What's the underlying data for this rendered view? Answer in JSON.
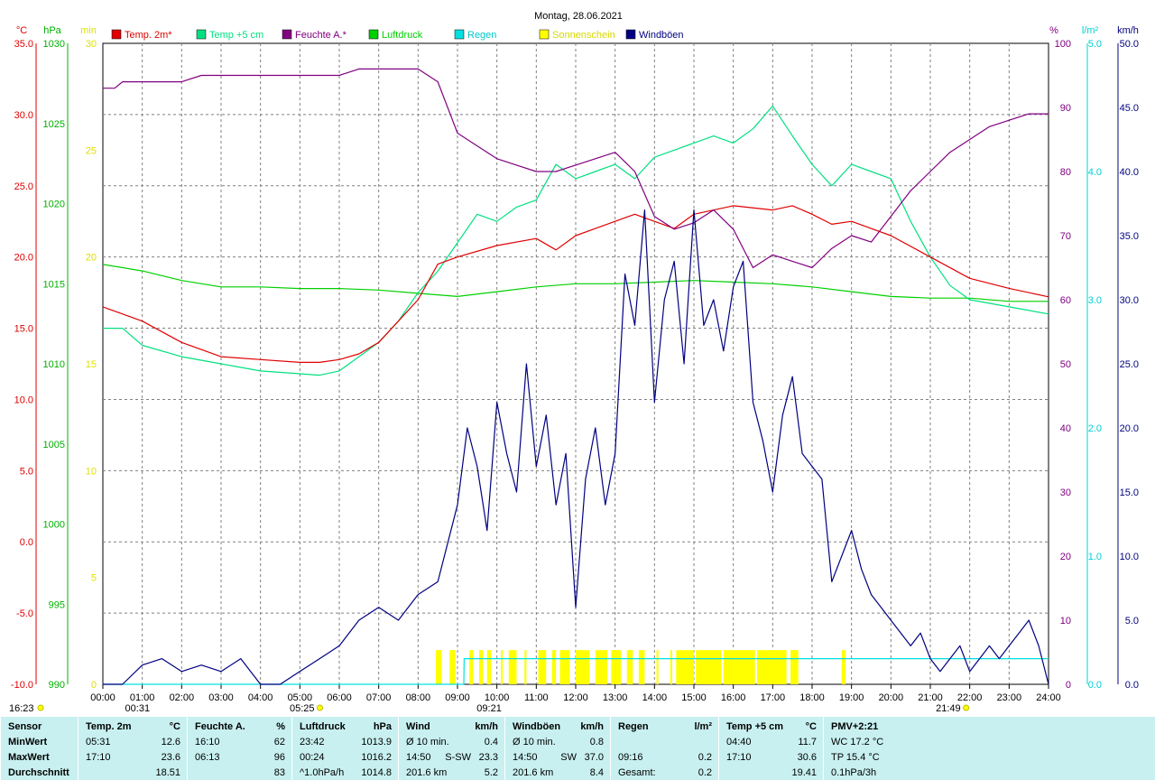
{
  "title": "Montag, 28.06.2021",
  "legend": [
    {
      "name": "Temp. 2m*",
      "color": "#e00000"
    },
    {
      "name": "Temp +5 cm",
      "color": "#00e080"
    },
    {
      "name": "Feuchte A.*",
      "color": "#800080"
    },
    {
      "name": "Luftdruck",
      "color": "#00d000"
    },
    {
      "name": "Regen",
      "color": "#00e0e0"
    },
    {
      "name": "Sonnenschein",
      "color": "#ffff00"
    },
    {
      "name": "Windböen",
      "color": "#000080"
    }
  ],
  "axes": {
    "temp": {
      "unit": "°C",
      "color": "#e00000",
      "ticks": [
        "35.0",
        "30.0",
        "25.0",
        "20.0",
        "15.0",
        "10.0",
        "5.0",
        "0.0",
        "-5.0",
        "-10.0"
      ]
    },
    "pressure": {
      "unit": "hPa",
      "color": "#00b000",
      "ticks": [
        "1030",
        "1025",
        "1020",
        "1015",
        "1010",
        "1005",
        "1000",
        "995",
        "990"
      ]
    },
    "sun": {
      "unit": "min",
      "color": "#e0e000",
      "ticks": [
        "30",
        "25",
        "20",
        "15",
        "10",
        "5",
        "0"
      ]
    },
    "humidity": {
      "unit": "%",
      "color": "#800080",
      "ticks": [
        "100",
        "90",
        "80",
        "70",
        "60",
        "50",
        "40",
        "30",
        "20",
        "10",
        "0"
      ]
    },
    "rain": {
      "unit": "l/m²",
      "color": "#00d0d0",
      "ticks": [
        "5.0",
        "4.0",
        "3.0",
        "2.0",
        "1.0",
        "0.0"
      ]
    },
    "wind": {
      "unit": "km/h",
      "color": "#000080",
      "ticks": [
        "50.0",
        "45.0",
        "40.0",
        "35.0",
        "30.0",
        "25.0",
        "20.0",
        "15.0",
        "10.0",
        "5.0",
        "0.0"
      ]
    },
    "time_ticks": [
      "00:00",
      "01:00",
      "02:00",
      "03:00",
      "04:00",
      "05:00",
      "06:00",
      "07:00",
      "08:00",
      "09:00",
      "10:00",
      "11:00",
      "12:00",
      "13:00",
      "14:00",
      "15:00",
      "16:00",
      "17:00",
      "18:00",
      "19:00",
      "20:00",
      "21:00",
      "22:00",
      "23:00",
      "24:00"
    ]
  },
  "markers": {
    "sunrise": "05:25",
    "sunset": "21:49",
    "moonset": "00:31",
    "moonrise": "09:21",
    "prev_time": "16:23"
  },
  "chart_data": {
    "type": "line",
    "title": "Montag, 28.06.2021",
    "x_range_hours": [
      0,
      24
    ],
    "temp_range": [
      -10,
      35
    ],
    "pressure_range": [
      990,
      1030
    ],
    "sun_range": [
      0,
      30
    ],
    "humidity_range": [
      0,
      100
    ],
    "rain_range": [
      0,
      5
    ],
    "wind_range": [
      0,
      50
    ],
    "grid": true,
    "series": [
      {
        "name": "Temp. 2m*",
        "axis": "temp",
        "x": [
          0,
          1,
          2,
          3,
          4,
          5,
          5.5,
          6,
          6.5,
          7,
          7.5,
          8,
          8.5,
          9,
          10,
          11,
          11.5,
          12,
          13,
          13.5,
          14,
          14.5,
          15,
          16,
          17,
          17.5,
          18,
          18.5,
          19,
          20,
          21,
          22,
          23,
          24
        ],
        "y": [
          16.5,
          15.5,
          14.0,
          13.0,
          12.8,
          12.6,
          12.6,
          12.8,
          13.2,
          14.0,
          15.5,
          17.0,
          19.5,
          20.0,
          20.8,
          21.3,
          20.5,
          21.5,
          22.5,
          23.0,
          22.5,
          22.0,
          23.0,
          23.6,
          23.3,
          23.6,
          23.0,
          22.3,
          22.5,
          21.5,
          20.0,
          18.5,
          17.8,
          17.2
        ]
      },
      {
        "name": "Temp +5 cm",
        "axis": "temp",
        "x": [
          0,
          0.5,
          1,
          2,
          3,
          4,
          5,
          5.5,
          6,
          6.5,
          7,
          7.5,
          8,
          8.5,
          9,
          9.5,
          10,
          10.5,
          11,
          11.5,
          12,
          12.5,
          13,
          13.5,
          14,
          14.5,
          15,
          15.5,
          16,
          16.5,
          17,
          17.5,
          18,
          18.5,
          19,
          19.5,
          20,
          20.5,
          21,
          21.5,
          22,
          23,
          24
        ],
        "y": [
          15.0,
          15.0,
          13.8,
          13.0,
          12.5,
          12.0,
          11.8,
          11.7,
          12.0,
          13.0,
          14.0,
          15.5,
          17.5,
          19.0,
          21.0,
          23.0,
          22.5,
          23.5,
          24.0,
          26.5,
          25.5,
          26.0,
          26.5,
          25.5,
          27.0,
          27.5,
          28.0,
          28.5,
          28.0,
          29.0,
          30.6,
          28.5,
          26.5,
          25.0,
          26.5,
          26.0,
          25.5,
          22.5,
          20.0,
          18.0,
          17.0,
          16.5,
          16.0
        ]
      },
      {
        "name": "Feuchte A.*",
        "axis": "humidity",
        "x": [
          0,
          0.3,
          0.5,
          1,
          2,
          2.5,
          3,
          4,
          5,
          6,
          6.5,
          7,
          7.5,
          8,
          8.5,
          9,
          9.5,
          10,
          10.5,
          11,
          11.5,
          12,
          12.5,
          13,
          13.5,
          14,
          14.5,
          15,
          15.5,
          16,
          16.5,
          17,
          17.5,
          18,
          18.5,
          19,
          19.5,
          20,
          20.5,
          21,
          21.5,
          22,
          22.5,
          23,
          23.5,
          24
        ],
        "y": [
          93,
          93,
          94,
          94,
          94,
          95,
          95,
          95,
          95,
          95,
          96,
          96,
          96,
          96,
          94,
          86,
          84,
          82,
          81,
          80,
          80,
          81,
          82,
          83,
          80,
          73,
          71,
          72,
          74,
          71,
          65,
          67,
          66,
          65,
          68,
          70,
          69,
          73,
          77,
          80,
          83,
          85,
          87,
          88,
          89,
          89
        ]
      },
      {
        "name": "Luftdruck",
        "axis": "pressure",
        "x": [
          0,
          1,
          2,
          3,
          4,
          5,
          6,
          7,
          8,
          9,
          10,
          11,
          12,
          13,
          14,
          15,
          16,
          17,
          18,
          19,
          20,
          21,
          22,
          23,
          24
        ],
        "y": [
          1016.2,
          1015.8,
          1015.2,
          1014.8,
          1014.8,
          1014.7,
          1014.7,
          1014.6,
          1014.4,
          1014.2,
          1014.5,
          1014.8,
          1015.0,
          1015.0,
          1015.1,
          1015.2,
          1015.1,
          1015.0,
          1014.8,
          1014.5,
          1014.2,
          1014.1,
          1014.1,
          1013.9,
          1013.9
        ]
      },
      {
        "name": "Regen",
        "axis": "rain",
        "x": [
          0,
          9.0,
          9.16,
          9.17,
          24
        ],
        "y": [
          0,
          0,
          0,
          0.2,
          0.2
        ]
      },
      {
        "name": "Sonnenschein",
        "axis": "sun",
        "intervals": [
          [
            8.45,
            8.6
          ],
          [
            8.8,
            8.95
          ],
          [
            9.3,
            9.4
          ],
          [
            9.55,
            9.65
          ],
          [
            9.75,
            9.85
          ],
          [
            10.1,
            10.15
          ],
          [
            10.3,
            10.5
          ],
          [
            10.7,
            10.75
          ],
          [
            11.05,
            11.25
          ],
          [
            11.4,
            11.5
          ],
          [
            11.6,
            11.85
          ],
          [
            12.0,
            12.35
          ],
          [
            12.5,
            12.8
          ],
          [
            12.9,
            13.15
          ],
          [
            13.3,
            13.45
          ],
          [
            13.6,
            13.75
          ],
          [
            14.05,
            14.1
          ],
          [
            14.4,
            14.45
          ],
          [
            14.55,
            15.0
          ],
          [
            15.05,
            15.7
          ],
          [
            15.75,
            16.55
          ],
          [
            16.6,
            17.35
          ],
          [
            17.45,
            17.65
          ],
          [
            18.75,
            18.85
          ]
        ],
        "level": 1.2
      },
      {
        "name": "Windböen",
        "axis": "wind",
        "x": [
          0,
          0.5,
          1,
          1.5,
          2,
          2.5,
          3,
          3.5,
          4,
          4.5,
          5,
          5.5,
          6,
          6.5,
          7,
          7.5,
          8,
          8.5,
          9,
          9.25,
          9.5,
          9.75,
          10,
          10.25,
          10.5,
          10.75,
          11,
          11.25,
          11.5,
          11.75,
          12,
          12.25,
          12.5,
          12.75,
          13,
          13.25,
          13.5,
          13.75,
          14,
          14.25,
          14.5,
          14.75,
          15,
          15.25,
          15.5,
          15.75,
          16,
          16.25,
          16.5,
          16.75,
          17,
          17.25,
          17.5,
          17.75,
          18,
          18.25,
          18.5,
          18.75,
          19,
          19.25,
          19.5,
          19.75,
          20,
          20.25,
          20.5,
          20.75,
          21,
          21.25,
          21.5,
          21.75,
          22,
          22.25,
          22.5,
          22.75,
          23,
          23.25,
          23.5,
          23.75,
          24
        ],
        "y": [
          0,
          0,
          1.5,
          2,
          1,
          1.5,
          1,
          2,
          0,
          0,
          1,
          2,
          3,
          5,
          6,
          5,
          7,
          8,
          14,
          20,
          17,
          12,
          22,
          18,
          15,
          25,
          17,
          21,
          14,
          18,
          6,
          16,
          20,
          14,
          18,
          32,
          28,
          37,
          22,
          30,
          33,
          25,
          37,
          28,
          30,
          26,
          31,
          33,
          22,
          19,
          15,
          21,
          24,
          18,
          17,
          16,
          8,
          10,
          12,
          9,
          7,
          6,
          5,
          4,
          3,
          4,
          2,
          1,
          2,
          3,
          1,
          2,
          3,
          2,
          3,
          4,
          5,
          3,
          0
        ]
      }
    ]
  },
  "stats": {
    "sensor": {
      "header": "Sensor",
      "rows": [
        "MinWert",
        "MaxWert",
        "Durchschnitt"
      ]
    },
    "temp": {
      "title": "Temp. 2m",
      "unit": "°C",
      "rows": [
        [
          "05:31",
          "12.6"
        ],
        [
          "17:10",
          "23.6"
        ],
        [
          "",
          "18.51"
        ]
      ]
    },
    "humidity": {
      "title": "Feuchte A.",
      "unit": "%",
      "rows": [
        [
          "16:10",
          "62"
        ],
        [
          "06:13",
          "96"
        ],
        [
          "",
          "83"
        ]
      ]
    },
    "pressure": {
      "title": "Luftdruck",
      "unit": "hPa",
      "rows": [
        [
          "23:42",
          "1013.9"
        ],
        [
          "00:24",
          "1016.2"
        ],
        [
          "^1.0hPa/h",
          "1014.8"
        ]
      ]
    },
    "wind": {
      "title": "Wind",
      "unit": "km/h",
      "rows": [
        [
          "Ø 10 min.",
          "",
          "0.4"
        ],
        [
          "14:50",
          "S-SW",
          "23.3"
        ],
        [
          "201.6 km",
          "",
          "5.2"
        ]
      ]
    },
    "gusts": {
      "title": "Windböen",
      "unit": "km/h",
      "rows": [
        [
          "Ø 10 min.",
          "",
          "0.8"
        ],
        [
          "14:50",
          "SW",
          "37.0"
        ],
        [
          "201.6 km",
          "",
          "8.4"
        ]
      ]
    },
    "rain": {
      "title": "Regen",
      "unit": "l/m²",
      "rows": [
        [
          "",
          ""
        ],
        [
          "09:16",
          "0.2"
        ],
        [
          "Gesamt:",
          "0.2"
        ]
      ]
    },
    "soil": {
      "title": "Temp +5 cm",
      "unit": "°C",
      "rows": [
        [
          "04:40",
          "11.7"
        ],
        [
          "17:10",
          "30.6"
        ],
        [
          "",
          "19.41"
        ]
      ]
    },
    "pmv": {
      "title": "PMV+2:21",
      "rows": [
        "WC 17.2 °C",
        "TP 15.4 °C",
        "0.1hPa/3h"
      ]
    }
  }
}
